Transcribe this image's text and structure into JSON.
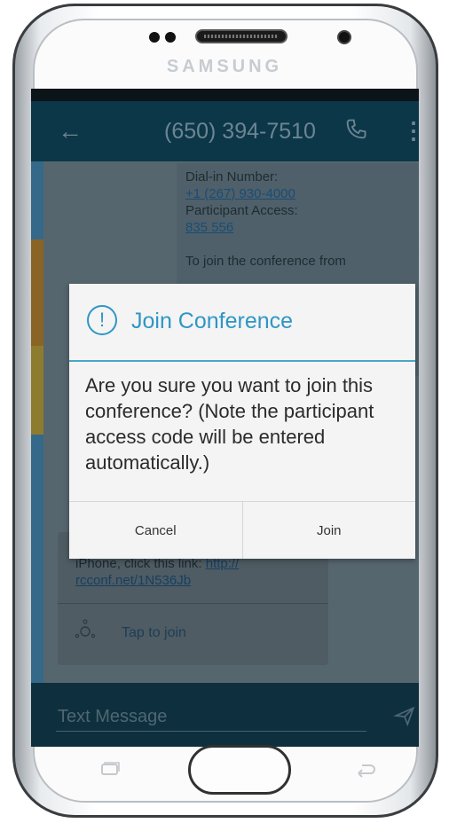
{
  "device": {
    "brand": "SAMSUNG"
  },
  "appbar": {
    "title": "(650) 394-7510"
  },
  "message": {
    "dial_in_label": "Dial-in Number:",
    "dial_in_number": "+1 (267) 930-4000",
    "access_label": "Participant Access:",
    "access_code": "835 556",
    "join_text": "To join the conference from"
  },
  "lower_message": {
    "prefix": "iPhone, click this link: ",
    "link_part1": "http://",
    "link_part2": "rcconf.net/1N536Jb",
    "tap_label": "Tap to join"
  },
  "composer": {
    "placeholder": "Text Message"
  },
  "dialog": {
    "title": "Join Conference",
    "message": "Are you sure you want to join this conference? (Note the participant access code will be entered automatically.)",
    "cancel_label": "Cancel",
    "join_label": "Join"
  },
  "colors": {
    "accent": "#2e96c6",
    "appbar": "#0c3748"
  }
}
